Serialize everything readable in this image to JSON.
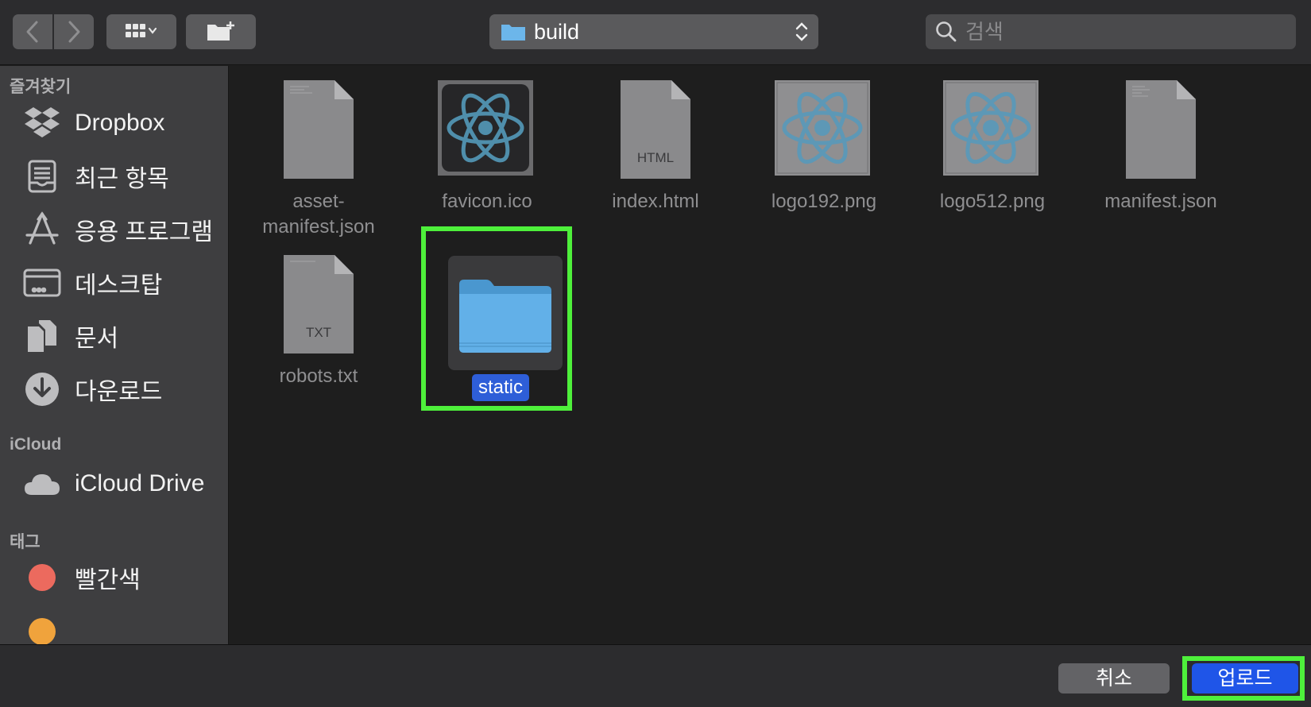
{
  "toolbar": {
    "path": "build",
    "search_placeholder": "검색"
  },
  "sidebar": {
    "sections": [
      {
        "title": "즐겨찾기"
      },
      {
        "title": "iCloud"
      },
      {
        "title": "태그"
      }
    ],
    "favorites": [
      {
        "label": "Dropbox",
        "icon": "dropbox-icon"
      },
      {
        "label": "최근 항목",
        "icon": "recents-icon"
      },
      {
        "label": "응용 프로그램",
        "icon": "applications-icon"
      },
      {
        "label": "데스크탑",
        "icon": "desktop-icon"
      },
      {
        "label": "문서",
        "icon": "documents-icon"
      },
      {
        "label": "다운로드",
        "icon": "downloads-icon"
      }
    ],
    "icloud": [
      {
        "label": "iCloud Drive",
        "icon": "cloud-icon"
      }
    ],
    "tags": [
      {
        "label": "빨간색",
        "color": "#ec6a5e"
      }
    ]
  },
  "files": [
    {
      "name": "asset-\nmanifest.json",
      "line1": "asset-",
      "line2": "manifest.json",
      "kind": "document"
    },
    {
      "name": "favicon.ico",
      "kind": "react-dark"
    },
    {
      "name": "index.html",
      "kind": "document",
      "badge": "HTML"
    },
    {
      "name": "logo192.png",
      "kind": "react-light"
    },
    {
      "name": "logo512.png",
      "kind": "react-light"
    },
    {
      "name": "manifest.json",
      "kind": "document"
    },
    {
      "name": "robots.txt",
      "kind": "document",
      "badge": "TXT"
    },
    {
      "name": "static",
      "kind": "folder",
      "selected": true
    }
  ],
  "footer": {
    "cancel_label": "취소",
    "upload_label": "업로드"
  },
  "colors": {
    "accent": "#1f55e8",
    "highlight": "#4ef03b",
    "folder": "#5aaee6",
    "react": "#5d98b6"
  }
}
